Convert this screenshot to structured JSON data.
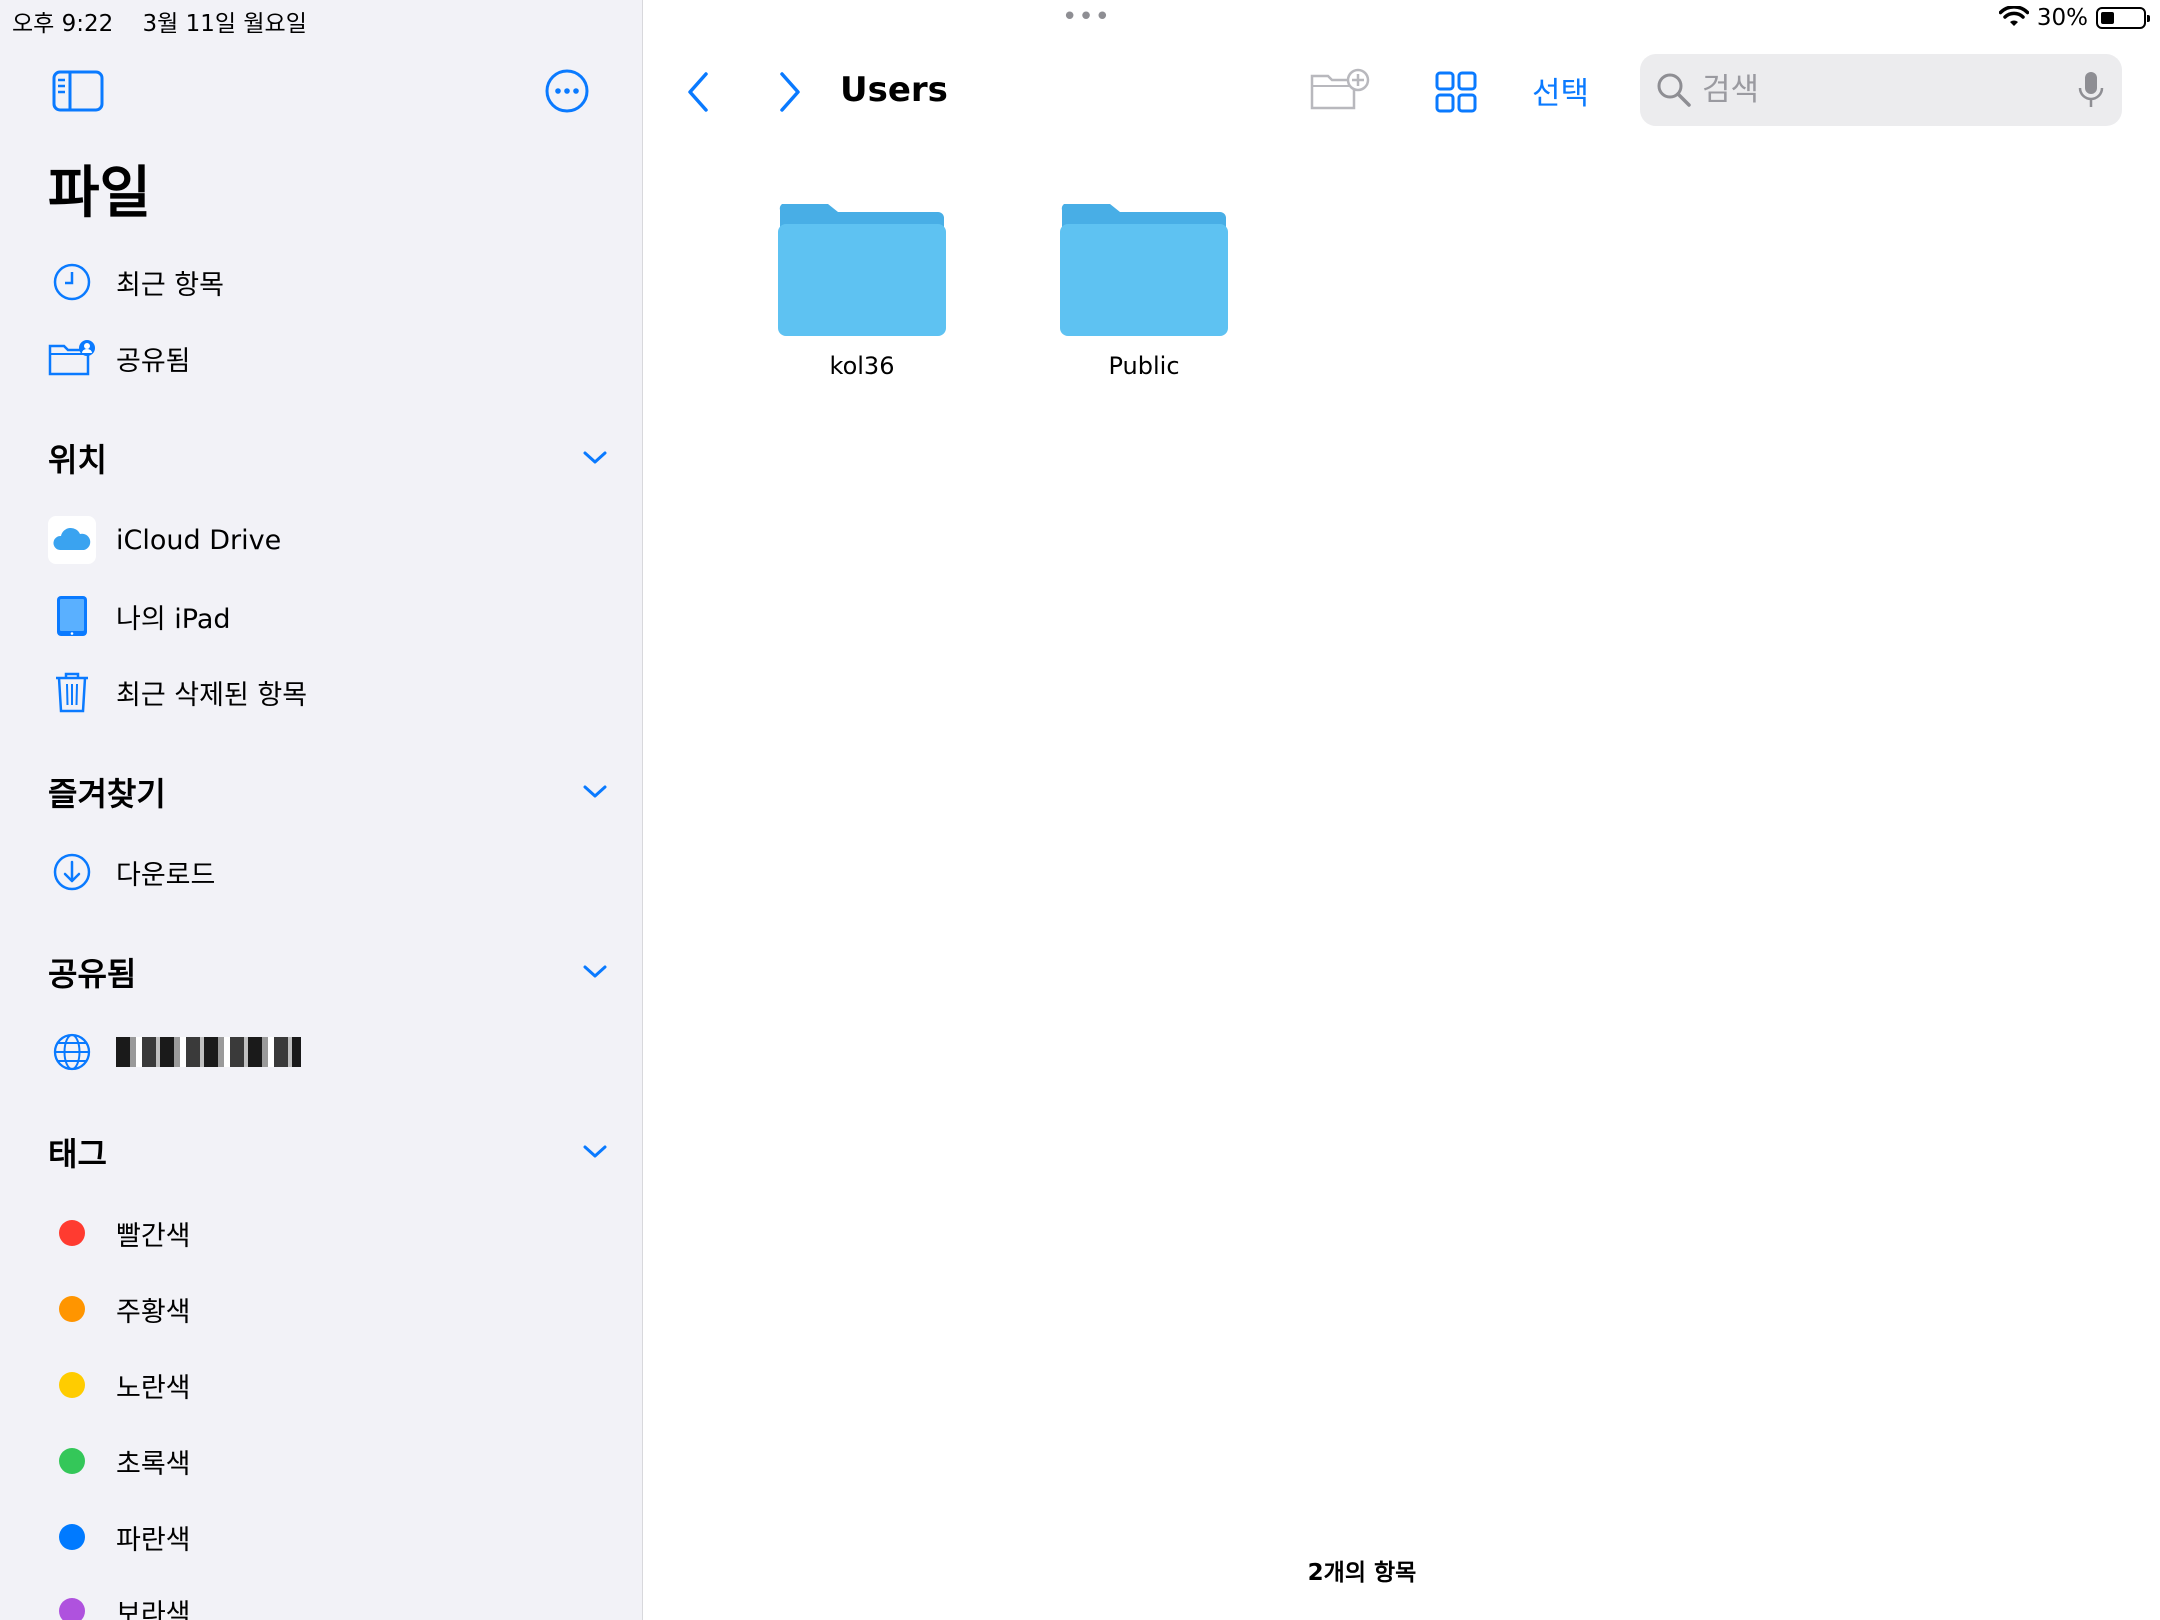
{
  "status_bar": {
    "time": "오후 9:22",
    "date": "3월 11일 월요일",
    "multitask_dots": "•••",
    "battery_percent": "30%",
    "battery_level": 0.3
  },
  "sidebar": {
    "title": "파일",
    "top_items": [
      {
        "label": "최근 항목",
        "icon": "clock-icon"
      },
      {
        "label": "공유됨",
        "icon": "shared-folder-icon"
      }
    ],
    "sections": {
      "locations": {
        "title": "위치",
        "items": [
          {
            "label": "iCloud Drive",
            "icon": "icloud-icon"
          },
          {
            "label": "나의 iPad",
            "icon": "ipad-icon"
          },
          {
            "label": "최근 삭제된 항목",
            "icon": "trash-icon"
          }
        ]
      },
      "favorites": {
        "title": "즐겨찾기",
        "items": [
          {
            "label": "다운로드",
            "icon": "download-icon"
          }
        ]
      },
      "shared": {
        "title": "공유됨",
        "items": [
          {
            "label": "",
            "icon": "globe-icon"
          }
        ]
      },
      "tags": {
        "title": "태그",
        "items": [
          {
            "label": "빨간색",
            "color": "#ff3b30"
          },
          {
            "label": "주황색",
            "color": "#ff9500"
          },
          {
            "label": "노란색",
            "color": "#ffcc00"
          },
          {
            "label": "초록색",
            "color": "#34c759"
          },
          {
            "label": "파란색",
            "color": "#007aff"
          },
          {
            "label": "보라색",
            "color": "#af52de"
          }
        ]
      }
    }
  },
  "toolbar": {
    "title": "Users",
    "select_label": "선택",
    "search_placeholder": "검색"
  },
  "content": {
    "folders": [
      {
        "name": "kol36"
      },
      {
        "name": "Public"
      }
    ],
    "item_count": "2개의 항목"
  },
  "colors": {
    "accent": "#0a7aff",
    "folder_front": "#5ec2f2",
    "folder_back": "#48aee6"
  }
}
